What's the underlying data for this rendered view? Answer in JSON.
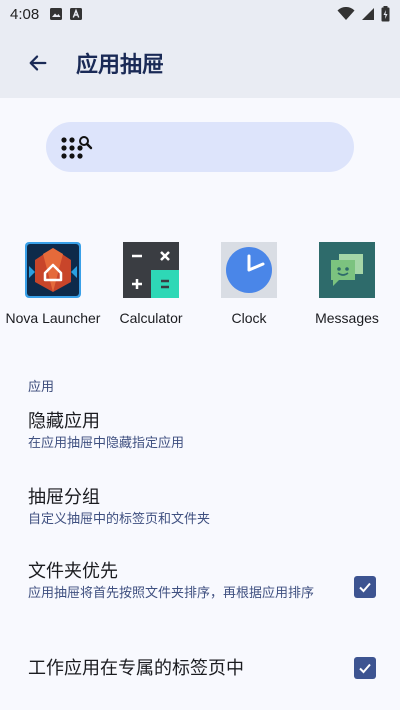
{
  "status_bar": {
    "time": "4:08",
    "left_icons": [
      "image-icon",
      "a-text-icon"
    ],
    "right_icons": [
      "wifi-icon",
      "signal-icon",
      "battery-icon"
    ]
  },
  "app_bar": {
    "title": "应用抽屉",
    "back_icon": "arrow-left-icon"
  },
  "search": {
    "icon": "dots-search-icon",
    "placeholder": ""
  },
  "apps": [
    {
      "label": "Nova Launcher",
      "icon": "nova-launcher-icon"
    },
    {
      "label": "Calculator",
      "icon": "calculator-icon"
    },
    {
      "label": "Clock",
      "icon": "clock-icon"
    },
    {
      "label": "Messages",
      "icon": "messages-icon"
    }
  ],
  "section": {
    "header": "应用",
    "prefs": [
      {
        "title": "隐藏应用",
        "summary": "在应用抽屉中隐藏指定应用"
      },
      {
        "title": "抽屉分组",
        "summary": "自定义抽屉中的标签页和文件夹"
      },
      {
        "title": "文件夹优先",
        "summary": "应用抽屉将首先按照文件夹排序，再根据应用排序",
        "checked": true
      },
      {
        "title": "工作应用在专属的标签页中",
        "checked": true
      }
    ]
  },
  "colors": {
    "accent": "#3d5491",
    "app_bar_bg": "#e9ecf3",
    "search_bg": "#dde4fb",
    "title": "#1a2a56"
  }
}
